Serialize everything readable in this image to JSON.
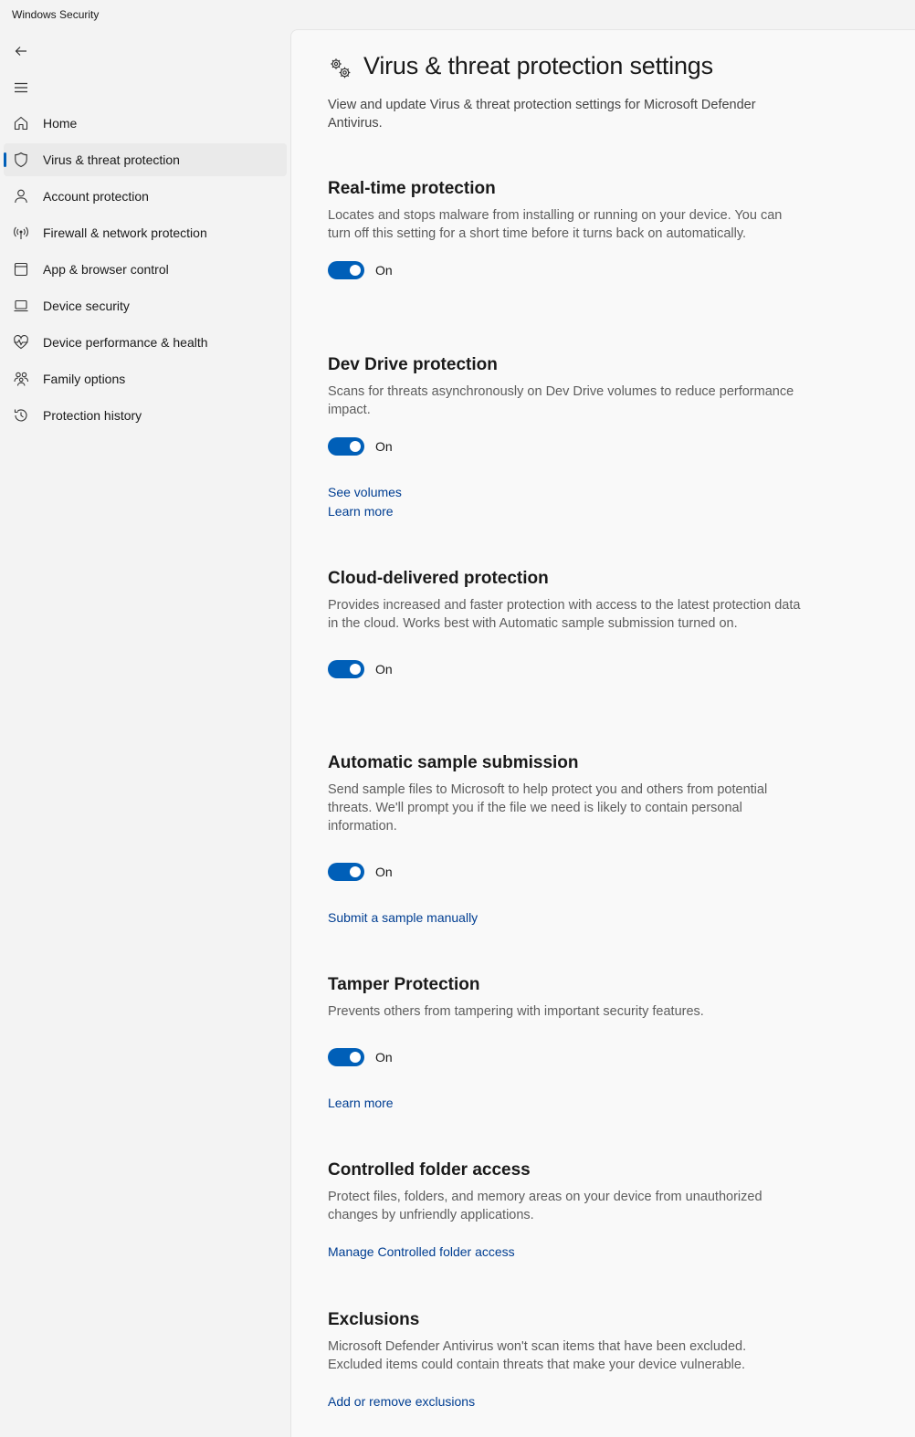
{
  "window": {
    "title": "Windows Security"
  },
  "nav": {
    "items": [
      {
        "label": "Home",
        "icon": "home-icon"
      },
      {
        "label": "Virus & threat protection",
        "icon": "shield-icon",
        "selected": true
      },
      {
        "label": "Account protection",
        "icon": "person-icon"
      },
      {
        "label": "Firewall & network protection",
        "icon": "wireless-icon"
      },
      {
        "label": "App & browser control",
        "icon": "app-window-icon"
      },
      {
        "label": "Device security",
        "icon": "laptop-icon"
      },
      {
        "label": "Device performance & health",
        "icon": "heart-pulse-icon"
      },
      {
        "label": "Family options",
        "icon": "family-icon"
      },
      {
        "label": "Protection history",
        "icon": "history-icon"
      }
    ]
  },
  "page": {
    "title": "Virus & threat protection settings",
    "description": "View and update Virus & threat protection settings for Microsoft Defender Antivirus."
  },
  "sections": {
    "realtime": {
      "title": "Real-time protection",
      "description": "Locates and stops malware from installing or running on your device. You can turn off this setting for a short time before it turns back on automatically.",
      "toggle": "On"
    },
    "devdrive": {
      "title": "Dev Drive protection",
      "description": "Scans for threats asynchronously on Dev Drive volumes to reduce performance impact.",
      "toggle": "On",
      "link1": "See volumes",
      "link2": "Learn more"
    },
    "cloud": {
      "title": "Cloud-delivered protection",
      "description": "Provides increased and faster protection with access to the latest protection data in the cloud. Works best with Automatic sample submission turned on.",
      "toggle": "On"
    },
    "sample": {
      "title": "Automatic sample submission",
      "description": "Send sample files to Microsoft to help protect you and others from potential threats. We'll prompt you if the file we need is likely to contain personal information.",
      "toggle": "On",
      "link1": "Submit a sample manually"
    },
    "tamper": {
      "title": "Tamper Protection",
      "description": "Prevents others from tampering with important security features.",
      "toggle": "On",
      "link1": "Learn more"
    },
    "cfa": {
      "title": "Controlled folder access",
      "description": "Protect files, folders, and memory areas on your device from unauthorized changes by unfriendly applications.",
      "link1": "Manage Controlled folder access"
    },
    "exclusions": {
      "title": "Exclusions",
      "description": "Microsoft Defender Antivirus won't scan items that have been excluded. Excluded items could contain threats that make your device vulnerable.",
      "link1": "Add or remove exclusions"
    }
  },
  "colors": {
    "accent": "#005fb8",
    "link": "#003e92"
  }
}
